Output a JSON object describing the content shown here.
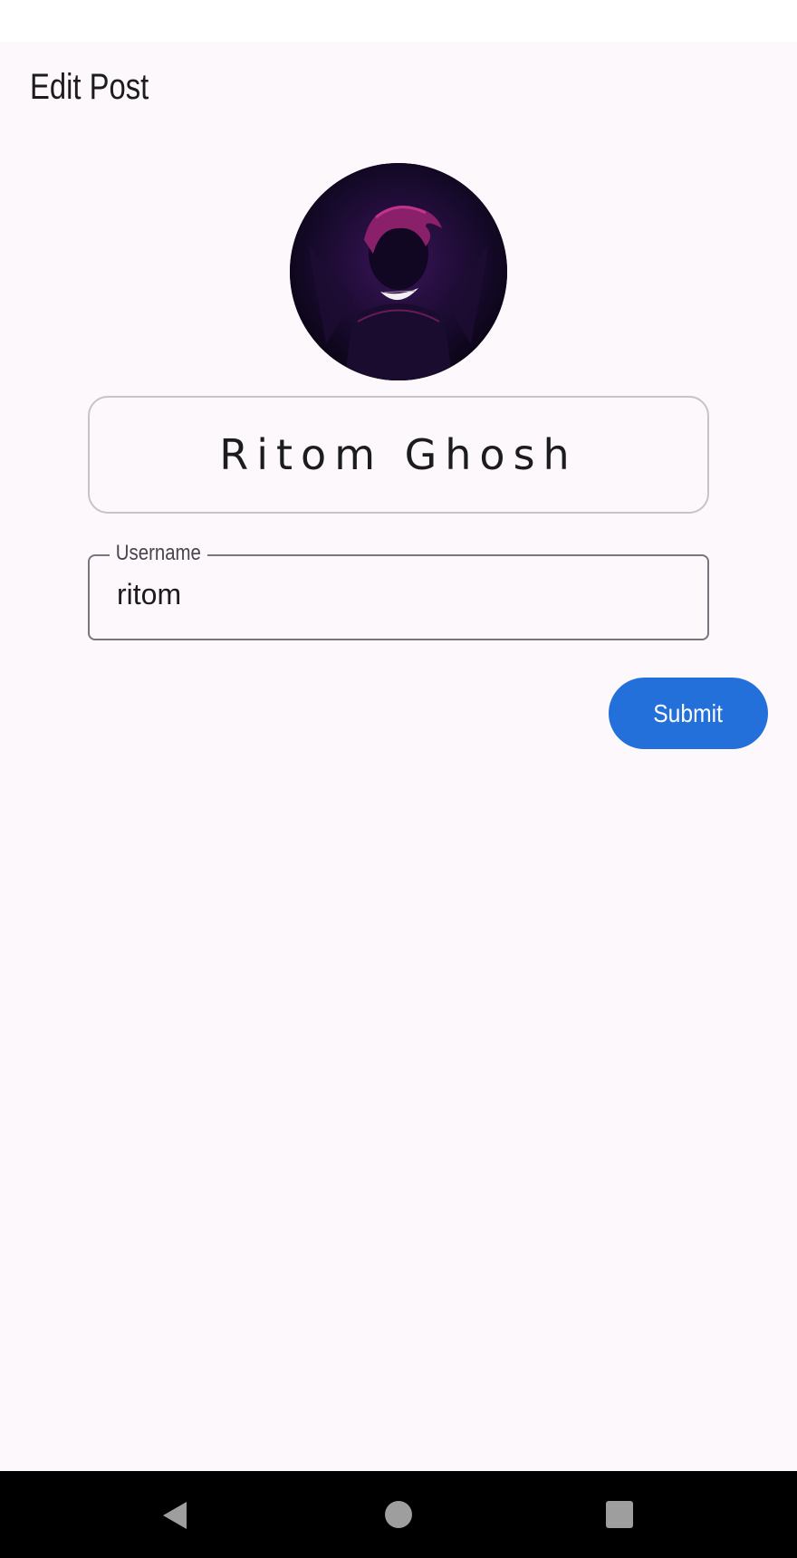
{
  "header": {
    "title": "Edit Post"
  },
  "profile": {
    "avatar_icon": "avatar-image",
    "display_name": "Ritom Ghosh"
  },
  "form": {
    "username_label": "Username",
    "username_value": "ritom",
    "submit_label": "Submit"
  },
  "nav": {
    "back_icon": "back-triangle-icon",
    "home_icon": "home-circle-icon",
    "recents_icon": "recents-square-icon"
  },
  "colors": {
    "background": "#fdf8fb",
    "accent": "#2470db",
    "text": "#1c1b1f"
  }
}
